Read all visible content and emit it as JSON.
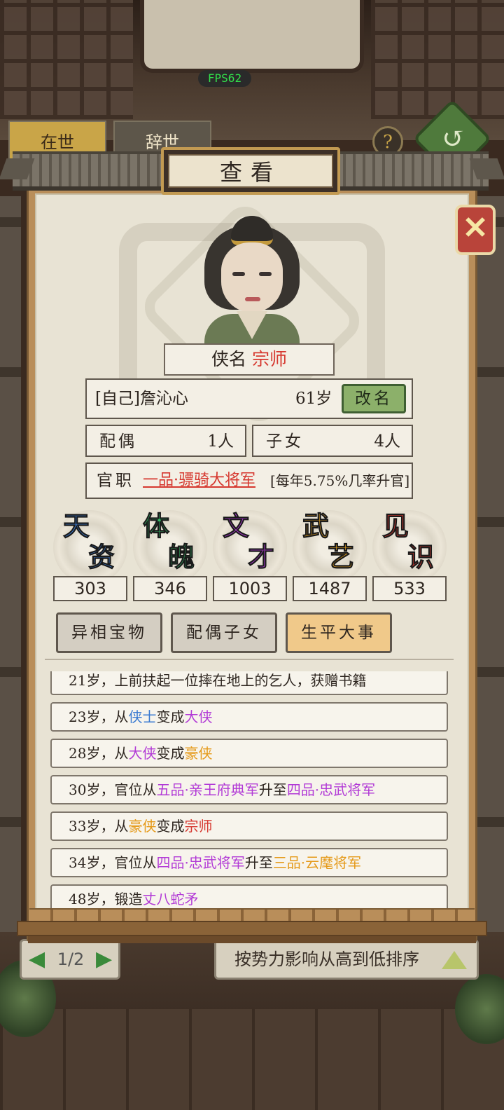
{
  "fps": "FPS62",
  "bg_tabs": [
    "在世",
    "辞世"
  ],
  "help": "?",
  "modal": {
    "title": "查看",
    "close": "✕",
    "nickname_label": "侠名",
    "nickname_value": "宗师",
    "name": "[自己]詹沁心",
    "age": "61岁",
    "rename": "改名",
    "spouse_label": "配偶",
    "spouse_value": "1人",
    "children_label": "子女",
    "children_value": "4人",
    "office_label": "官职",
    "office_value": "一品·骠骑大将军",
    "office_rate": "[每年5.75%几率升官]"
  },
  "attributes": [
    {
      "c1": "天",
      "c2": "资",
      "value": "303",
      "color": "#3a7ad1"
    },
    {
      "c1": "体",
      "c2": "魄",
      "value": "346",
      "color": "#37b765"
    },
    {
      "c1": "文",
      "c2": "才",
      "value": "1003",
      "color": "#b23ad6"
    },
    {
      "c1": "武",
      "c2": "艺",
      "value": "1487",
      "color": "#e5a11f"
    },
    {
      "c1": "见",
      "c2": "识",
      "value": "533",
      "color": "#d6382f"
    }
  ],
  "tabs": [
    "异相宝物",
    "配偶子女",
    "生平大事"
  ],
  "events": [
    {
      "parts": [
        {
          "t": "21岁，上前扶起一位摔在地上的乞人，获赠书籍",
          "c": ""
        }
      ]
    },
    {
      "parts": [
        {
          "t": "23岁，从",
          "c": ""
        },
        {
          "t": "侠士",
          "c": "c-blue"
        },
        {
          "t": "变成",
          "c": ""
        },
        {
          "t": "大侠",
          "c": "c-purple"
        }
      ]
    },
    {
      "parts": [
        {
          "t": "28岁，从",
          "c": ""
        },
        {
          "t": "大侠",
          "c": "c-purple"
        },
        {
          "t": "变成",
          "c": ""
        },
        {
          "t": "豪侠",
          "c": "c-orange"
        }
      ]
    },
    {
      "parts": [
        {
          "t": "30岁，官位从",
          "c": ""
        },
        {
          "t": "五品·亲王府典军",
          "c": "c-purple"
        },
        {
          "t": "升至",
          "c": ""
        },
        {
          "t": "四品·忠武将军",
          "c": "c-purple"
        }
      ]
    },
    {
      "parts": [
        {
          "t": "33岁，从",
          "c": ""
        },
        {
          "t": "豪侠",
          "c": "c-orange"
        },
        {
          "t": "变成",
          "c": ""
        },
        {
          "t": "宗师",
          "c": "c-red"
        }
      ]
    },
    {
      "parts": [
        {
          "t": "34岁，官位从",
          "c": ""
        },
        {
          "t": "四品·忠武将军",
          "c": "c-purple"
        },
        {
          "t": "升至",
          "c": ""
        },
        {
          "t": "三品·云麾将军",
          "c": "c-orange"
        }
      ]
    },
    {
      "parts": [
        {
          "t": "48岁，锻造",
          "c": ""
        },
        {
          "t": "丈八蛇矛",
          "c": "c-purple"
        }
      ]
    }
  ],
  "footer": {
    "page": "1/2",
    "sort_label": "按势力影响从高到低排序"
  }
}
